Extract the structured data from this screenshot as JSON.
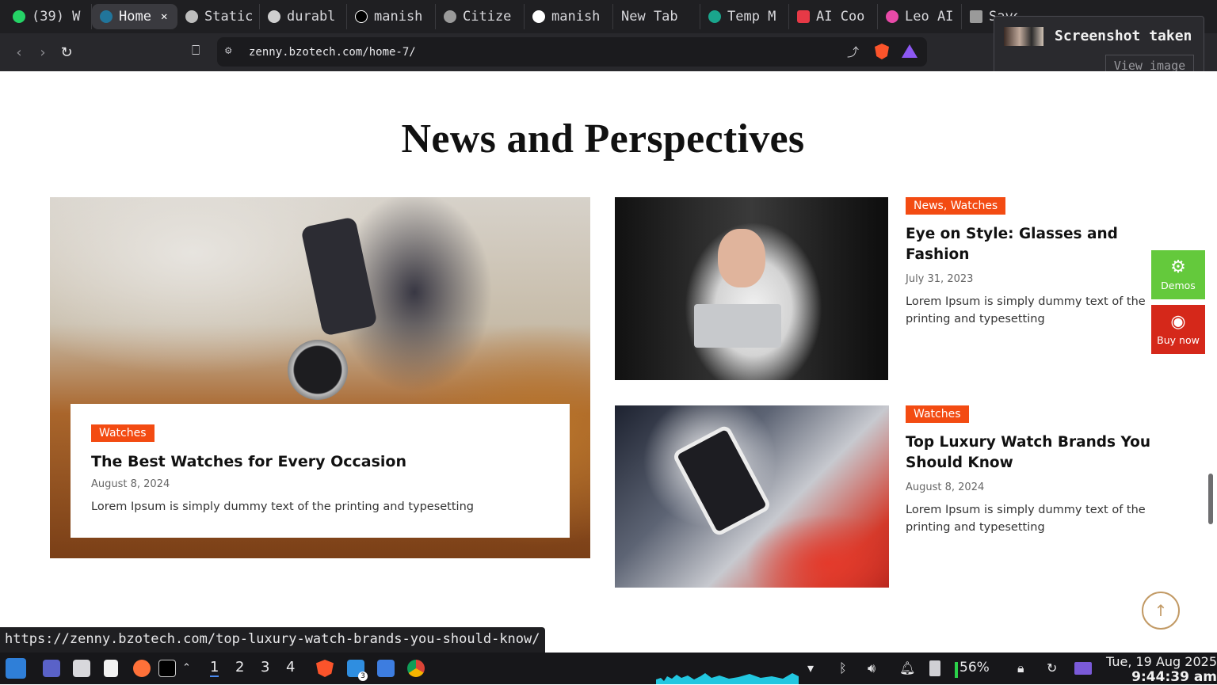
{
  "browser": {
    "tabs": [
      {
        "label": "(39) W",
        "fav_color": "#25d366",
        "fav": "whatsapp-icon"
      },
      {
        "label": "Home",
        "fav_color": "#21759b",
        "fav": "wordpress-icon",
        "active": true
      },
      {
        "label": "Static",
        "fav_color": "#bdbdbd",
        "fav": "openai-icon"
      },
      {
        "label": "durabl",
        "fav_color": "#cfcfcf",
        "fav": "durable-icon"
      },
      {
        "label": "manish",
        "fav_color": "#000000",
        "fav": "bolt-icon"
      },
      {
        "label": "Citize",
        "fav_color": "#9a9a9a",
        "fav": "globe-icon"
      },
      {
        "label": "manish",
        "fav_color": "#ffffff",
        "fav": "github-icon"
      },
      {
        "label": "New Tab",
        "fav_color": "",
        "fav": ""
      },
      {
        "label": "Temp M",
        "fav_color": "#1aa58c",
        "fav": "temp-mail-icon"
      },
      {
        "label": "AI Coo",
        "fav_color": "#e63946",
        "fav": "cube-icon"
      },
      {
        "label": "Leo AI",
        "fav_color": "#e84aa8",
        "fav": "leo-icon"
      },
      {
        "label": "Save",
        "fav_color": "#9a9a9a",
        "fav": "save-icon"
      }
    ],
    "url": "zenny.bzotech.com/home-7/",
    "notification": {
      "title": "Screenshot taken",
      "action": "View image"
    },
    "status_url": "https://zenny.bzotech.com/top-luxury-watch-brands-you-should-know/"
  },
  "page": {
    "section_title": "News and Perspectives",
    "featured": {
      "tag": "Watches",
      "title": "The Best Watches for Every Occasion",
      "date": "August 8, 2024",
      "excerpt": "Lorem Ipsum is simply dummy text of the printing and typesetting"
    },
    "posts": [
      {
        "tag": "News, Watches",
        "title": "Eye on Style: Glasses and Fashion",
        "date": "July 31, 2023",
        "excerpt": "Lorem Ipsum is simply dummy text of the printing and typesetting"
      },
      {
        "tag": "Watches",
        "title": "Top Luxury Watch Brands You Should Know",
        "date": "August 8, 2024",
        "excerpt": "Lorem Ipsum is simply dummy text of the printing and typesetting"
      }
    ],
    "sticky": {
      "demos": "Demos",
      "buy_now": "Buy now"
    },
    "colors": {
      "accent": "#f34b12",
      "demos": "#64c93c",
      "buy_now": "#d5281a",
      "back_to_top": "#c29a65"
    }
  },
  "taskbar": {
    "workspaces": [
      "1",
      "2",
      "3",
      "4"
    ],
    "vscode_badge": "3",
    "battery": "56%",
    "date": "Tue, 19 Aug 2025",
    "time": "9:44:39 am"
  }
}
